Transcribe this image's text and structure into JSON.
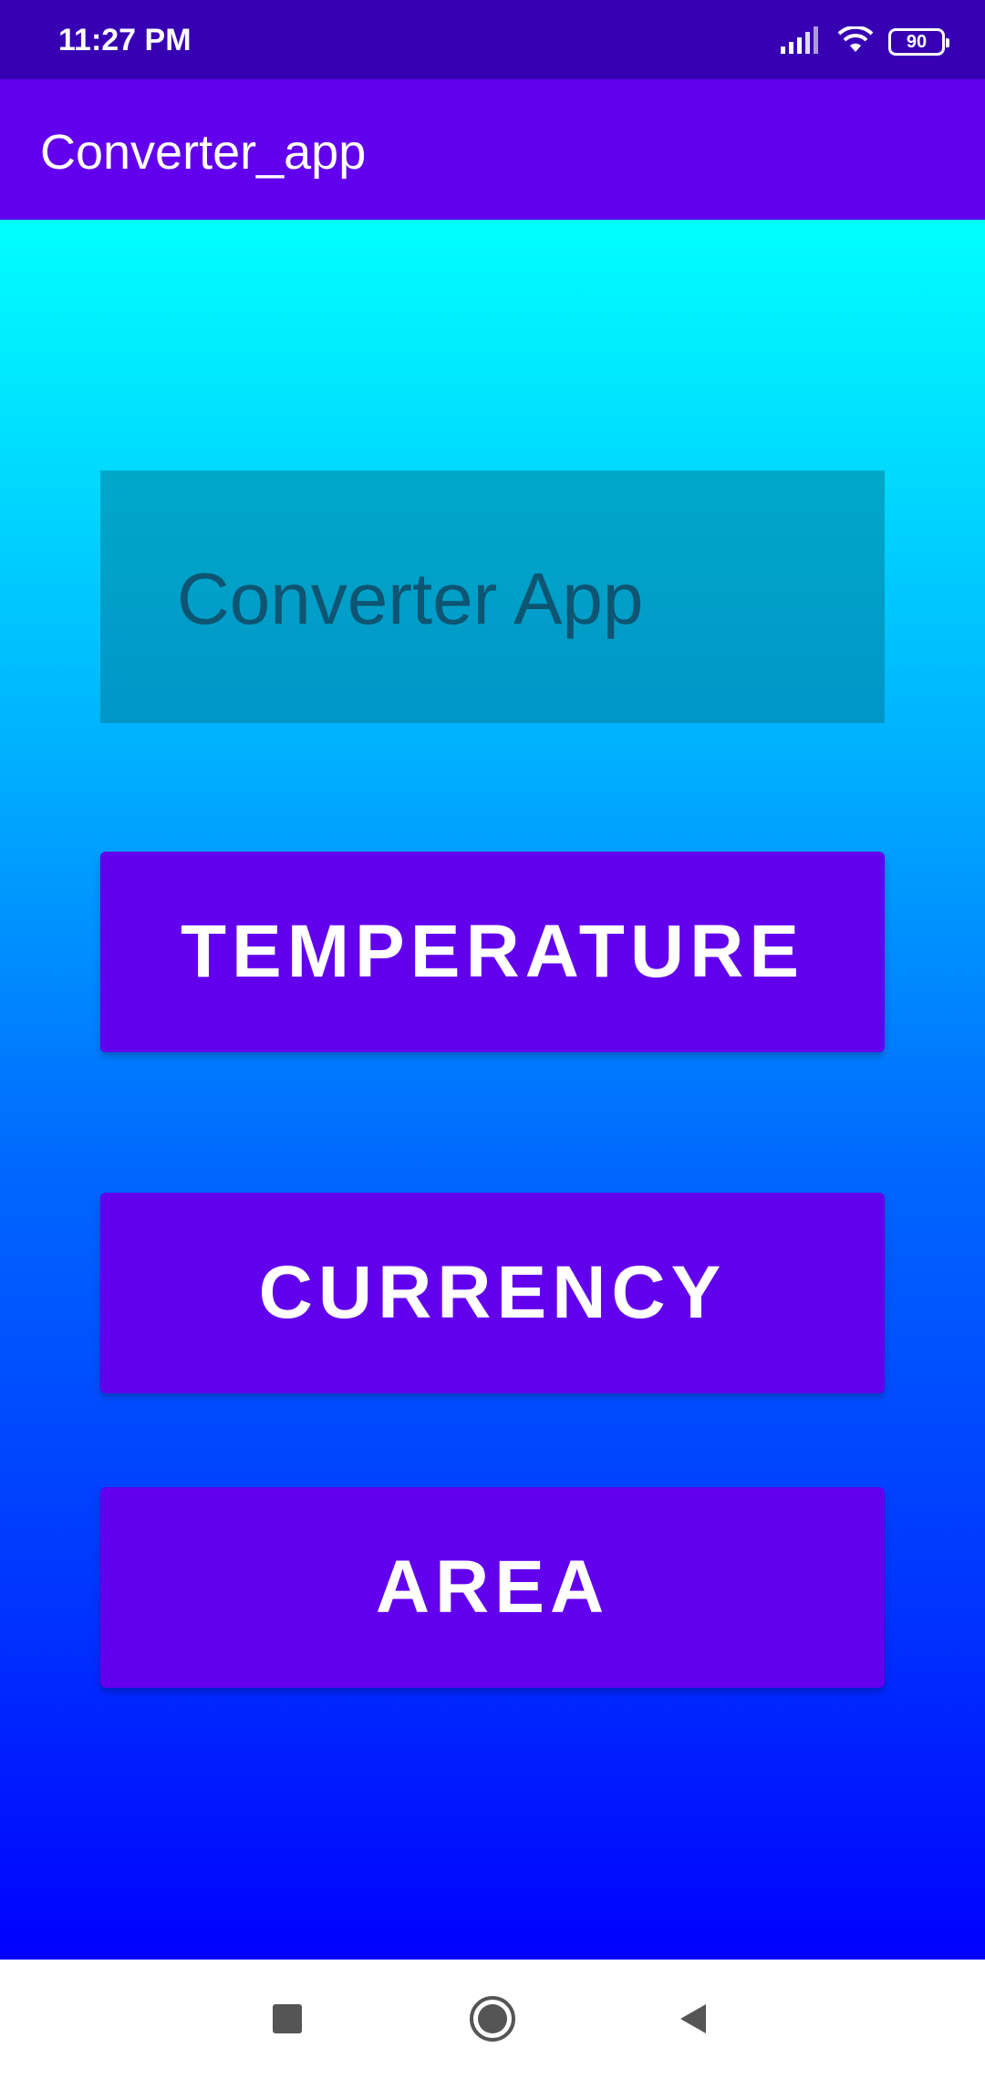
{
  "status_bar": {
    "time": "11:27 PM",
    "battery_level": "90",
    "icons": [
      "signal-icon",
      "wifi-icon",
      "battery-icon"
    ]
  },
  "app_bar": {
    "title": "Converter_app"
  },
  "main": {
    "heading": "Converter App",
    "buttons": {
      "temperature": "TEMPERATURE",
      "currency": "CURRENCY",
      "area": "AREA"
    }
  },
  "nav_bar": {
    "icons": [
      "recent-apps-icon",
      "home-icon",
      "back-icon"
    ]
  },
  "colors": {
    "status_bar": "#3700b3",
    "app_bar": "#6200ee",
    "button": "#6200ee",
    "gradient_top": "#00ffff",
    "gradient_bottom": "#0000ff",
    "heading_box": "#00a0c8",
    "heading_text": "#0d5572"
  }
}
